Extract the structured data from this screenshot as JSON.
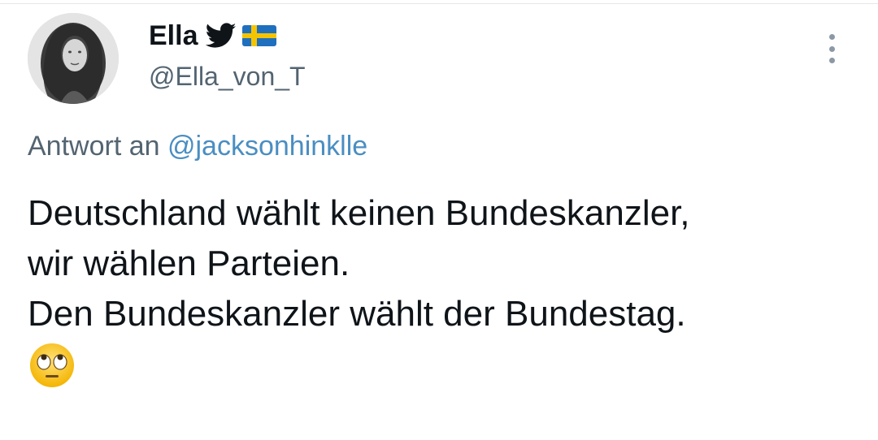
{
  "tweet": {
    "author": {
      "display_name": "Ella",
      "handle": "@Ella_von_T",
      "badges": [
        "twitter-bird-icon",
        "sweden-flag-icon"
      ]
    },
    "menu_icon": "more-vertical-icon",
    "reply_to": {
      "prefix": "Antwort an",
      "mention": "@jacksonhinklle"
    },
    "text_lines": [
      "Deutschland wählt keinen Bundeskanzler,",
      "wir wählen Parteien.",
      "Den Bundeskanzler wählt der Bundestag."
    ],
    "emoji": "face-with-rolling-eyes-emoji"
  },
  "colors": {
    "text_primary": "#0f1419",
    "text_secondary": "#536471",
    "mention": "#4a8ec2",
    "flag_blue": "#1f6fbf",
    "flag_yellow": "#f5c400"
  }
}
